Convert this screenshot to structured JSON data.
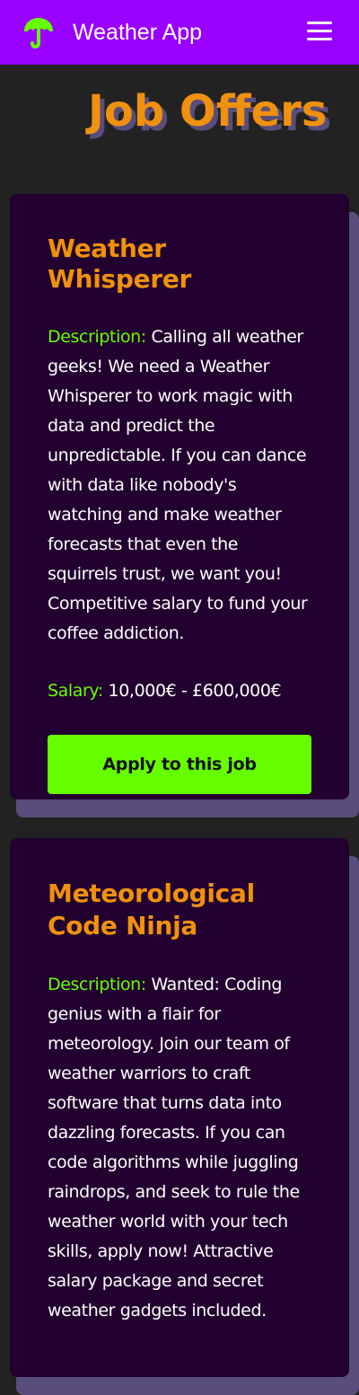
{
  "nav": {
    "brand_name": "Weather App",
    "brand_color": "#66ff00",
    "background_color": "#9900ff",
    "logo_icon": "umbrella-icon",
    "menu_icon": "hamburger-menu-icon"
  },
  "page": {
    "title": "Job Offers",
    "title_color": "#f0910d",
    "title_shadow_color": "#584d7c"
  },
  "labels": {
    "description": "Description:",
    "salary": "Salary:"
  },
  "jobs": [
    {
      "title": "Weather Whisperer",
      "description": "Calling all weather geeks! We need a Weather Whisperer to work magic with data and predict the unpredictable. If you can dance with data like nobody's watching and make weather forecasts that even the squirrels trust, we want you! Competitive salary to fund your coffee addiction.",
      "salary": "10,000€ - £600,000€",
      "apply_label": "Apply to this job"
    },
    {
      "title": "Meteorological Code Ninja",
      "description": "Wanted: Coding genius with a flair for meteorology. Join our team of weather warriors to craft software that turns data into dazzling forecasts. If you can code algorithms while juggling raindrops, and seek to rule the weather world with your tech skills, apply now! Attractive salary package and secret weather gadgets included."
    }
  ],
  "colors": {
    "page_background": "#222222",
    "card_background": "#22002f",
    "accent_green": "#66ff00",
    "accent_orange": "#f0910d"
  }
}
